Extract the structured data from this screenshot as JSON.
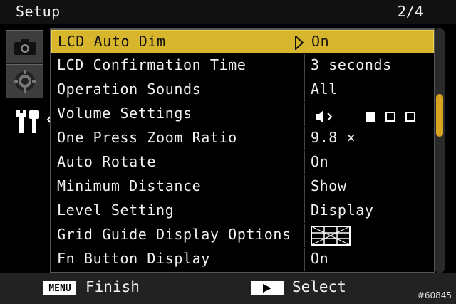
{
  "header": {
    "title": "Setup",
    "page": "2/4"
  },
  "tabs": [
    {
      "icon": "camera-icon"
    },
    {
      "icon": "mode-dial-icon"
    },
    {
      "icon": "wrench-setup-icon",
      "active": true
    }
  ],
  "menu": {
    "selected_index": 0,
    "items": [
      {
        "label": "LCD Auto Dim",
        "value": "On"
      },
      {
        "label": "LCD Confirmation Time",
        "value": "3 seconds"
      },
      {
        "label": "Operation Sounds",
        "value": "All"
      },
      {
        "label": "Volume Settings",
        "value": "",
        "volume_level": 1,
        "volume_max": 3
      },
      {
        "label": "One Press Zoom Ratio",
        "value": "9.8 ×"
      },
      {
        "label": "Auto Rotate",
        "value": "On"
      },
      {
        "label": "Minimum Distance",
        "value": "Show"
      },
      {
        "label": "Level Setting",
        "value": "Display"
      },
      {
        "label": "Grid Guide Display Options",
        "value": "",
        "icon": "grid-guide-icon"
      },
      {
        "label": "Fn Button Display",
        "value": "On"
      }
    ]
  },
  "scrollbar": {
    "position_fraction": 0.27
  },
  "footer": {
    "menu_key": "MENU",
    "finish_label": "Finish",
    "select_label": "Select"
  },
  "watermark": "#60845",
  "colors": {
    "highlight": "#d7b52c",
    "scroll_thumb": "#d7a420"
  }
}
